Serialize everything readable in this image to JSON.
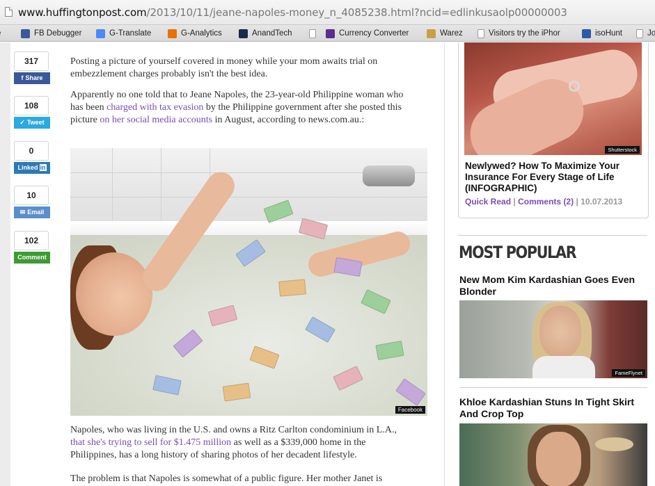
{
  "browser": {
    "url_host": "www.huffingtonpost.com",
    "url_path": "/2013/10/11/jeane-napoles-money_n_4085238.html?ncid=edlinkusaolp00000003",
    "bookmarks": [
      {
        "label": "gle",
        "icon": "doc-icon"
      },
      {
        "label": "FB Debugger",
        "icon": "facebook-icon"
      },
      {
        "label": "G-Translate",
        "icon": "translate-icon"
      },
      {
        "label": "G-Analytics",
        "icon": "analytics-icon"
      },
      {
        "label": "AnandTech",
        "icon": "anandtech-icon"
      },
      {
        "label": "",
        "icon": "doc-icon"
      },
      {
        "label": "Currency Converter",
        "icon": "yahoo-icon"
      },
      {
        "label": "Warez",
        "icon": "warez-icon"
      },
      {
        "label": "Visitors try the iPhor",
        "icon": "doc-icon"
      },
      {
        "label": "isoHunt",
        "icon": "isohunt-icon"
      },
      {
        "label": "Jo",
        "icon": "doc-icon"
      }
    ]
  },
  "share": [
    {
      "count": "317",
      "label": "Share",
      "icon": "facebook-icon"
    },
    {
      "count": "108",
      "label": "Tweet",
      "icon": "twitter-icon"
    },
    {
      "count": "0",
      "label": "Linked",
      "icon": "linkedin-icon"
    },
    {
      "count": "10",
      "label": "Email",
      "icon": "email-icon"
    },
    {
      "count": "102",
      "label": "Comment",
      "icon": "comment-icon"
    }
  ],
  "article": {
    "p1": "Posting a picture of yourself covered in money while your mom awaits trial on embezzlement charges probably isn't the best idea.",
    "p2_a": "Apparently no one told that to Jeane Napoles, the 23-year-old Philippine woman who has been ",
    "p2_link1": "charged with tax evasion",
    "p2_b": " by the Philippine government after she posted this picture ",
    "p2_link2": "on her social media accounts",
    "p2_c": " in August, according to news.com.au.:",
    "photo_credit": "Facebook",
    "p3_a": "Napoles, who was living in the U.S. and owns a Ritz Carlton condominium in L.A., ",
    "p3_link": "that she's trying to sell for $1.475 million",
    "p3_b": " as well as a $339,000 home in the Philippines, has a long history of sharing photos of her decadent lifestyle.",
    "p4": "The problem is that Napoles is somewhat of a public figure. Her mother Janet is"
  },
  "sidebar": {
    "feature": {
      "image_credit": "Shutterstock",
      "title": "Newlywed? How To Maximize Your Insurance For Every Stage of Life (INFOGRAPHIC)",
      "quick_read": "Quick Read",
      "comments": "Comments (2)",
      "date": "10.07.2013"
    },
    "most_popular_heading": "MOST POPULAR",
    "items": [
      {
        "title": "New Mom Kim Kardashian Goes Even Blonder",
        "credit": "FameFlynet"
      },
      {
        "title": "Khloe Kardashian Stuns In Tight Skirt And Crop Top"
      }
    ]
  }
}
